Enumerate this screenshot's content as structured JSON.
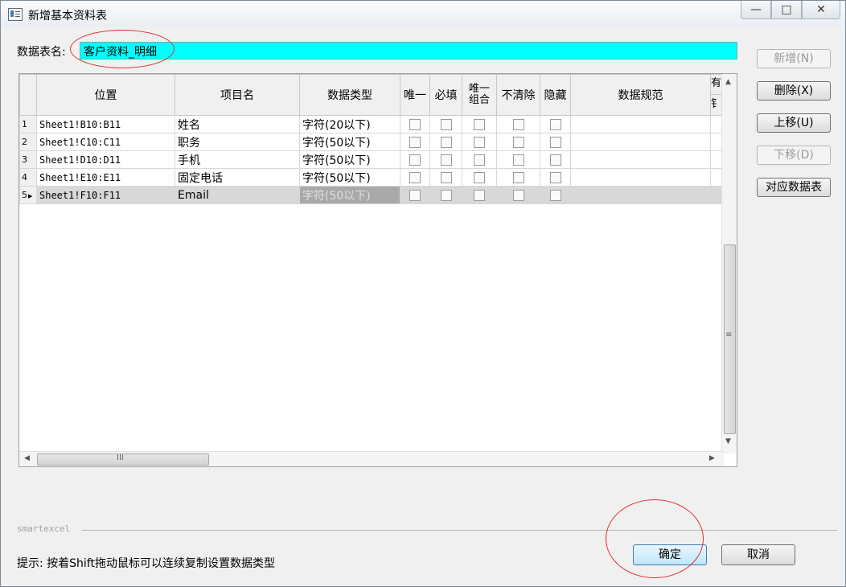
{
  "window": {
    "title": "新增基本资料表",
    "controls": {
      "minimize": "—",
      "maximize": "□",
      "close": "✕"
    }
  },
  "form": {
    "table_name_label": "数据表名:",
    "table_name_value": "客户资料_明细"
  },
  "grid": {
    "columns": [
      "位置",
      "项目名",
      "数据类型",
      "唯一",
      "必填",
      "唯一组合",
      "不清除",
      "隐藏",
      "数据规范",
      "有",
      "钅"
    ],
    "rows": [
      {
        "num": "1",
        "pos": "Sheet1!B10:B11",
        "name": "姓名",
        "type": "字符(20以下)",
        "selected": false
      },
      {
        "num": "2",
        "pos": "Sheet1!C10:C11",
        "name": "职务",
        "type": "字符(50以下)",
        "selected": false
      },
      {
        "num": "3",
        "pos": "Sheet1!D10:D11",
        "name": "手机",
        "type": "字符(50以下)",
        "selected": false
      },
      {
        "num": "4",
        "pos": "Sheet1!E10:E11",
        "name": "固定电话",
        "type": "字符(50以下)",
        "selected": false
      },
      {
        "num": "5",
        "pos": "Sheet1!F10:F11",
        "name": "Email",
        "type": "字符(50以下)",
        "selected": true
      }
    ],
    "scroll": {
      "hthumb_label": "III",
      "vthumb_label": "≡"
    }
  },
  "side_buttons": [
    {
      "label": "新增(N)",
      "enabled": false
    },
    {
      "label": "删除(X)",
      "enabled": true
    },
    {
      "label": "上移(U)",
      "enabled": true
    },
    {
      "label": "下移(D)",
      "enabled": false
    },
    {
      "label": "对应数据表",
      "enabled": true
    }
  ],
  "footer": {
    "brand": "smartexcel",
    "hint": "提示: 按着Shift拖动鼠标可以连续复制设置数据类型",
    "ok_label": "确定",
    "cancel_label": "取消"
  },
  "colors": {
    "name_field_bg": "#00ffff",
    "annotation": "#e03030",
    "selected_row": "#d8d8d8"
  }
}
